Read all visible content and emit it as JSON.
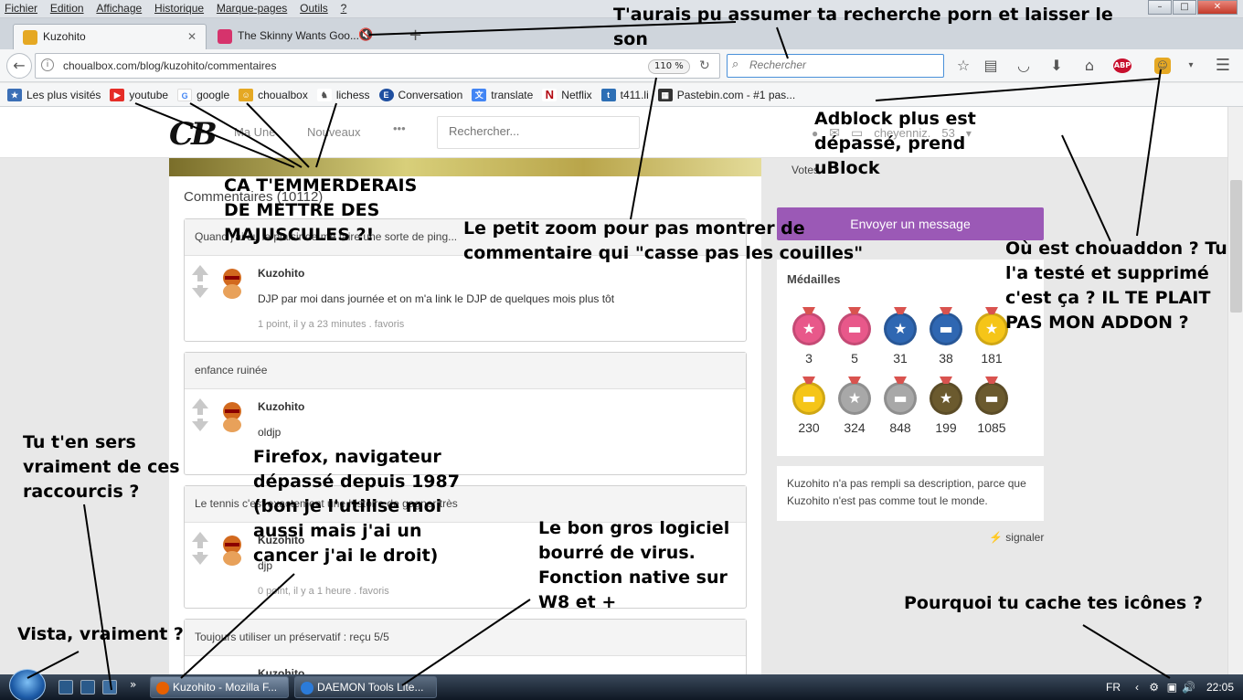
{
  "menubar": {
    "items": [
      "Fichier",
      "Edition",
      "Affichage",
      "Historique",
      "Marque-pages",
      "Outils",
      "?"
    ]
  },
  "tabs": [
    {
      "label": "Kuzohito",
      "active": true
    },
    {
      "label": "The Skinny Wants Goo...",
      "active": false
    }
  ],
  "navbar": {
    "url": "choualbox.com/blog/kuzohito/commentaires",
    "zoom": "110 %",
    "search_placeholder": "Rechercher"
  },
  "bookmarks": [
    {
      "label": "Les plus visités",
      "icon": "star-folder-icon",
      "color": "#3b6fb6"
    },
    {
      "label": "youtube",
      "icon": "youtube-icon",
      "color": "#e52d27"
    },
    {
      "label": "google",
      "icon": "google-icon",
      "color": "#4285f4"
    },
    {
      "label": "choualbox",
      "icon": "choualbox-icon",
      "color": "#e5a823"
    },
    {
      "label": "lichess",
      "icon": "knight-icon",
      "color": "#555555"
    },
    {
      "label": "Conversation",
      "icon": "conversation-icon",
      "color": "#1f4fa0"
    },
    {
      "label": "translate",
      "icon": "translate-icon",
      "color": "#4285f4"
    },
    {
      "label": "Netflix",
      "icon": "netflix-icon",
      "color": "#b20710"
    },
    {
      "label": "t411.li",
      "icon": "t411-icon",
      "color": "#2d6fb5"
    },
    {
      "label": "Pastebin.com - #1 pas...",
      "icon": "pastebin-icon",
      "color": "#333333"
    }
  ],
  "site": {
    "logo": "CB",
    "nav": [
      "Ma Une",
      "Nouveaux",
      "•••"
    ],
    "search_placeholder": "Rechercher...",
    "user": "cheyenniz.",
    "user_count": "53"
  },
  "comments_header": "Commentaires (10112)",
  "threads": [
    {
      "title": "Quand j'ai eu le plaisir de me faire une sorte de ping...",
      "author": "Kuzohito",
      "text": "DJP par moi dans journée et on m'a link le DJP de quelques mois plus tôt",
      "meta": "1 point, il y a 23 minutes . favoris"
    },
    {
      "title": "enfance ruinée",
      "author": "Kuzohito",
      "text": "oldjp",
      "meta": ""
    },
    {
      "title": "Le tennis c'est exactement une histoire de gagner très",
      "author": "Kuzohito",
      "text": "djp",
      "meta": "0 point, il y a 1 heure . favoris"
    },
    {
      "title": "Toujours utiliser un préservatif : reçu 5/5",
      "author": "Kuzohito",
      "text": "",
      "meta": ""
    }
  ],
  "sidebar": {
    "votes_label": "Votes",
    "send_message": "Envoyer un message",
    "medals_title": "Médailles",
    "medals": [
      {
        "count": "3",
        "color": "#e8588a",
        "icon": "star-icon"
      },
      {
        "count": "5",
        "color": "#e8588a",
        "icon": "speech-icon"
      },
      {
        "count": "31",
        "color": "#2f67b2",
        "icon": "star-icon"
      },
      {
        "count": "38",
        "color": "#2f67b2",
        "icon": "speech-icon"
      },
      {
        "count": "181",
        "color": "#f5c518",
        "icon": "star-icon"
      },
      {
        "count": "230",
        "color": "#f5c518",
        "icon": "speech-icon"
      },
      {
        "count": "324",
        "color": "#a8a8a8",
        "icon": "star-icon"
      },
      {
        "count": "848",
        "color": "#a8a8a8",
        "icon": "speech-icon"
      },
      {
        "count": "199",
        "color": "#6b5a2e",
        "icon": "star-icon"
      },
      {
        "count": "1085",
        "color": "#6b5a2e",
        "icon": "speech-icon"
      }
    ],
    "description": "Kuzohito n'a pas rempli sa description, parce que Kuzohito n'est pas comme tout le monde.",
    "report": "signaler"
  },
  "taskbar": {
    "buttons": [
      "Kuzohito - Mozilla F...",
      "DAEMON Tools Lite..."
    ],
    "lang": "FR",
    "time": "22:05"
  },
  "annotations": [
    "T'aurais pu assumer ta recherche porn et laisser le son",
    "Adblock plus est dépassé, prend uBlock",
    "CA T'EMMERDERAIS DE METTRE DES MAJUSCULES ?!",
    "Le petit zoom pour pas montrer de commentaire qui \"casse pas les couilles\"",
    "Où est chouaddon ? Tu l'a testé et supprimé c'est ça ? IL TE PLAIT PAS MON ADDON ?",
    "Tu t'en sers vraiment de ces raccourcis ?",
    "Firefox, navigateur dépassé depuis 1987 (bon je l'utilise moi aussi mais j'ai un cancer j'ai le droit)",
    "Le bon gros logiciel bourré de virus. Fonction native sur W8 et +",
    "Pourquoi tu cache tes icônes ?",
    "Vista, vraiment ?"
  ]
}
